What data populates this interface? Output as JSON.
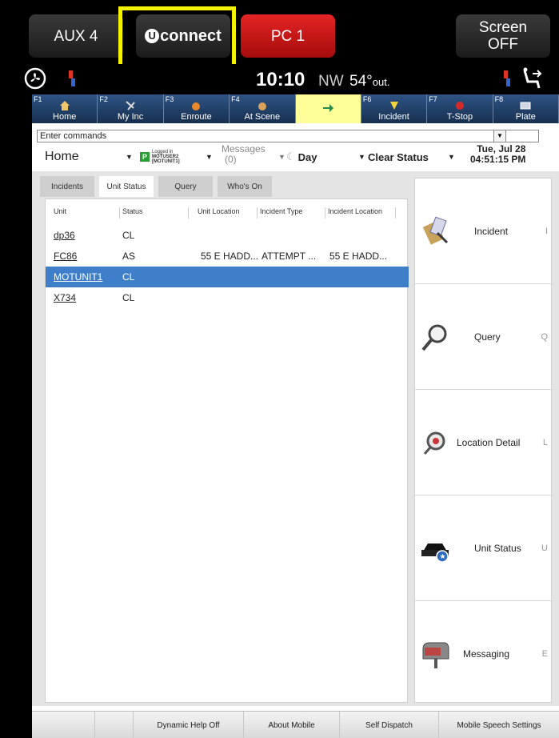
{
  "topbar": {
    "aux_label": "AUX 4",
    "uconnect_label": "connect",
    "uconnect_logo_letter": "U",
    "pc_label": "PC 1",
    "screen_off_label": "Screen OFF",
    "highlight_color": "#f3f300",
    "pc_color": "#e52424"
  },
  "status": {
    "time": "10:10",
    "heading": "NW",
    "outside_temp": "54°",
    "outside_label": "out."
  },
  "fkeys": [
    {
      "num": "F1",
      "label": "Home",
      "icon": "home-icon"
    },
    {
      "num": "F2",
      "label": "My Inc",
      "icon": "my-incident-icon"
    },
    {
      "num": "F3",
      "label": "Enroute",
      "icon": "enroute-icon"
    },
    {
      "num": "F4",
      "label": "At Scene",
      "icon": "at-scene-icon"
    },
    {
      "num": "",
      "label": "",
      "icon": "arrow-icon"
    },
    {
      "num": "F6",
      "label": "Incident",
      "icon": "incident-icon"
    },
    {
      "num": "F7",
      "label": "T-Stop",
      "icon": "traffic-stop-icon"
    },
    {
      "num": "F8",
      "label": "Plate",
      "icon": "plate-icon"
    }
  ],
  "command": {
    "placeholder": "Enter commands"
  },
  "toolbar": {
    "home": "Home",
    "login_line1": "Logged in",
    "login_line2": "MOTUSER2",
    "login_line3": "[MOTUNIT1]",
    "login_badge": "P",
    "messages_label": "Messages",
    "messages_count": "(0)",
    "day_label": "Day",
    "clear_status_label": "Clear Status",
    "date": "Tue, Jul 28",
    "time": "04:51:15 PM"
  },
  "tabs": [
    "Incidents",
    "Unit Status",
    "Query",
    "Who's On"
  ],
  "table": {
    "headers": [
      "Unit",
      "Status",
      "Unit Location",
      "Incident Type",
      "Incident Location"
    ],
    "rows": [
      {
        "unit": "dp36",
        "status": "CL",
        "unit_location": "",
        "incident_type": "",
        "incident_location": ""
      },
      {
        "unit": "FC86",
        "status": "AS",
        "unit_location": "55 E HADD...",
        "incident_type": "ATTEMPT ...",
        "incident_location": "55 E HADD..."
      },
      {
        "unit": "MOTUNIT1",
        "status": "CL",
        "unit_location": "",
        "incident_type": "",
        "incident_location": ""
      },
      {
        "unit": "X734",
        "status": "CL",
        "unit_location": "",
        "incident_type": "",
        "incident_location": ""
      }
    ],
    "selected_row_color": "#3f7fca"
  },
  "side_menu": [
    {
      "label": "Incident",
      "key": "I",
      "icon": "incident-clipboard-icon"
    },
    {
      "label": "Query",
      "key": "Q",
      "icon": "magnifier-icon"
    },
    {
      "label": "Location Detail",
      "key": "L",
      "icon": "location-detail-icon"
    },
    {
      "label": "Unit Status",
      "key": "U",
      "icon": "police-car-icon"
    },
    {
      "label": "Messaging",
      "key": "E",
      "icon": "mailbox-icon"
    }
  ],
  "bottom": [
    "Dynamic Help Off",
    "About Mobile",
    "Self Dispatch",
    "Mobile Speech Settings"
  ]
}
